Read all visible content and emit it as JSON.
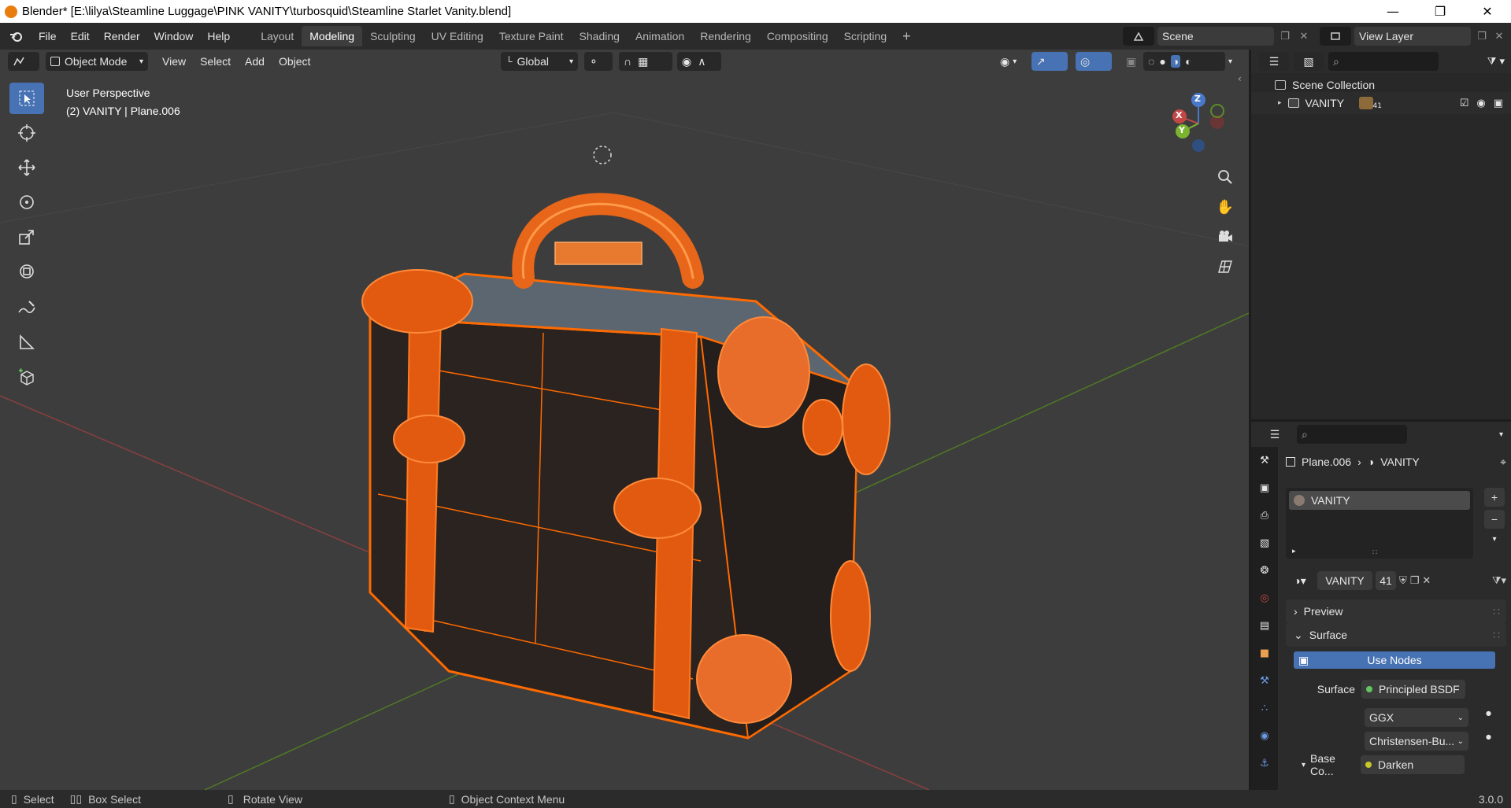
{
  "window": {
    "title": "Blender* [E:\\lilya\\Steamline Luggage\\PINK VANITY\\turbosquid\\Steamline Starlet  Vanity.blend]",
    "minimize": "—",
    "restore": "❐",
    "close": "✕"
  },
  "menu": [
    "File",
    "Edit",
    "Render",
    "Window",
    "Help"
  ],
  "workspaces": [
    {
      "label": "Layout",
      "active": false
    },
    {
      "label": "Modeling",
      "active": true
    },
    {
      "label": "Sculpting",
      "active": false
    },
    {
      "label": "UV Editing",
      "active": false
    },
    {
      "label": "Texture Paint",
      "active": false
    },
    {
      "label": "Shading",
      "active": false
    },
    {
      "label": "Animation",
      "active": false
    },
    {
      "label": "Rendering",
      "active": false
    },
    {
      "label": "Compositing",
      "active": false
    },
    {
      "label": "Scripting",
      "active": false
    }
  ],
  "add_workspace": "+",
  "scene": {
    "label": "Scene"
  },
  "view_layer": {
    "label": "View Layer"
  },
  "viewport": {
    "mode": "Object Mode",
    "menus": [
      "View",
      "Select",
      "Add",
      "Object"
    ],
    "transform_orientation": "Global",
    "perspective_label": "User Perspective",
    "object_label": "(2) VANITY | Plane.006",
    "gizmo_axes": {
      "x": "X",
      "y": "Y",
      "z": "Z"
    },
    "colors": {
      "bg": "#3d3d3d",
      "wire": "#ff6a00",
      "x_axis": "#c24848",
      "y_axis": "#5c8a2a",
      "accent": "#4772b3"
    }
  },
  "outliner": {
    "root": "Scene Collection",
    "items": [
      {
        "label": "VANITY",
        "count": "41"
      }
    ]
  },
  "properties": {
    "breadcrumb": {
      "object": "Plane.006",
      "material": "VANITY"
    },
    "material_slot": "VANITY",
    "material_name": "VANITY",
    "users": "41",
    "panels": {
      "preview": "Preview",
      "surface": "Surface",
      "use_nodes": "Use Nodes",
      "surface_label": "Surface",
      "surface_value": "Principled BSDF",
      "distribution": "GGX",
      "subsurface": "Christensen-Bu...",
      "base_color_label": "Base Co...",
      "base_color_value": "Darken"
    }
  },
  "statusbar": {
    "select": "Select",
    "box_select": "Box Select",
    "rotate_view": "Rotate View",
    "context_menu": "Object Context Menu",
    "version": "3.0.0"
  }
}
